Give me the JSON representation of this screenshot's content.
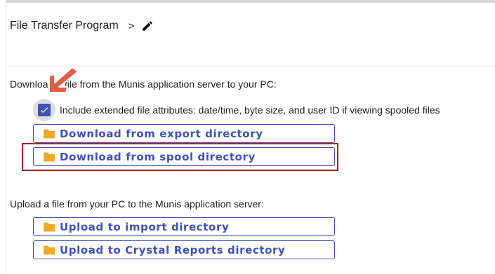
{
  "header": {
    "title": "File Transfer Program",
    "separator": ">",
    "edit_icon": "pencil-icon"
  },
  "download_section": {
    "label": "Download a file from the Munis application server to your PC:",
    "checkbox": {
      "checked": true,
      "label": "Include extended file attributes: date/time, byte size, and user ID if viewing spooled files"
    },
    "buttons": [
      {
        "label": "Download from export directory",
        "icon": "folder-icon"
      },
      {
        "label": "Download from spool directory",
        "icon": "folder-icon"
      }
    ]
  },
  "upload_section": {
    "label": "Upload a file from your PC to the Munis application server:",
    "buttons": [
      {
        "label": "Upload to import directory",
        "icon": "folder-icon"
      },
      {
        "label": "Upload to Crystal Reports directory",
        "icon": "folder-icon"
      }
    ]
  },
  "colors": {
    "accent": "#3f51b5",
    "folder": "#f9a825",
    "highlight_box": "#b71c1c",
    "annotation_arrow": "#e25d43"
  }
}
